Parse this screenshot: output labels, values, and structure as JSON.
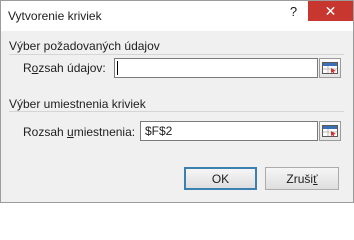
{
  "window": {
    "title": "Vytvorenie kriviek",
    "help_label": "?",
    "close_label": "✕"
  },
  "data_group": {
    "legend": "Výber požadovaných údajov",
    "range_label_pre": "R",
    "range_label_under": "o",
    "range_label_post": "zsah údajov:",
    "range_value": ""
  },
  "location_group": {
    "legend": "Výber umiestnenia kriviek",
    "location_label_pre": "Rozsah ",
    "location_label_under": "u",
    "location_label_post": "miestnenia:",
    "location_value": "$F$2"
  },
  "buttons": {
    "ok_label": "OK",
    "cancel_label_pre": "Zruši",
    "cancel_label_under": "ť"
  },
  "icons": {
    "range_picker": "collapse-dialog-icon",
    "help": "help-icon",
    "close": "close-icon"
  }
}
